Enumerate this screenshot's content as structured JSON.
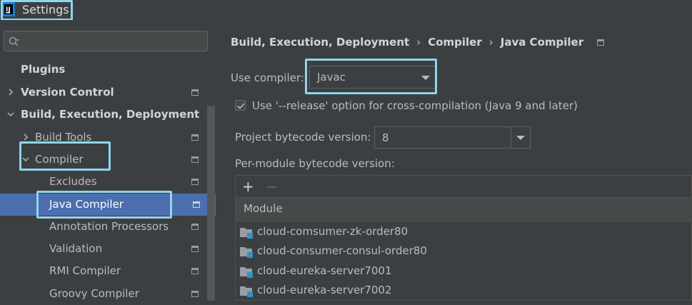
{
  "window": {
    "title": "Settings"
  },
  "search": {
    "placeholder": ""
  },
  "sidebar": {
    "items": [
      {
        "label": "Plugins"
      },
      {
        "label": "Version Control"
      },
      {
        "label": "Build, Execution, Deployment"
      },
      {
        "label": "Build Tools"
      },
      {
        "label": "Compiler"
      },
      {
        "label": "Excludes"
      },
      {
        "label": "Java Compiler"
      },
      {
        "label": "Annotation Processors"
      },
      {
        "label": "Validation"
      },
      {
        "label": "RMI Compiler"
      },
      {
        "label": "Groovy Compiler"
      }
    ],
    "selected": "Java Compiler"
  },
  "breadcrumb": [
    "Build, Execution, Deployment",
    "Compiler",
    "Java Compiler"
  ],
  "form": {
    "use_compiler_label": "Use compiler:",
    "use_compiler_value": "Javac",
    "release_option_label": "Use '--release' option for cross-compilation (Java 9 and later)",
    "release_option_checked": true,
    "bytecode_label": "Project bytecode version:",
    "bytecode_value": "8",
    "per_module_label": "Per-module bytecode version:"
  },
  "module_table": {
    "add_label": "+",
    "remove_label": "−",
    "header": "Module",
    "rows": [
      "cloud-comsumer-zk-order80",
      "cloud-consumer-consul-order80",
      "cloud-eureka-server7001",
      "cloud-eureka-server7002"
    ]
  },
  "colors": {
    "background": "#3c3f41",
    "selection": "#4b6eaf",
    "highlight_box": "#8fd5ec",
    "module_icon_accent": "#3592c4"
  }
}
